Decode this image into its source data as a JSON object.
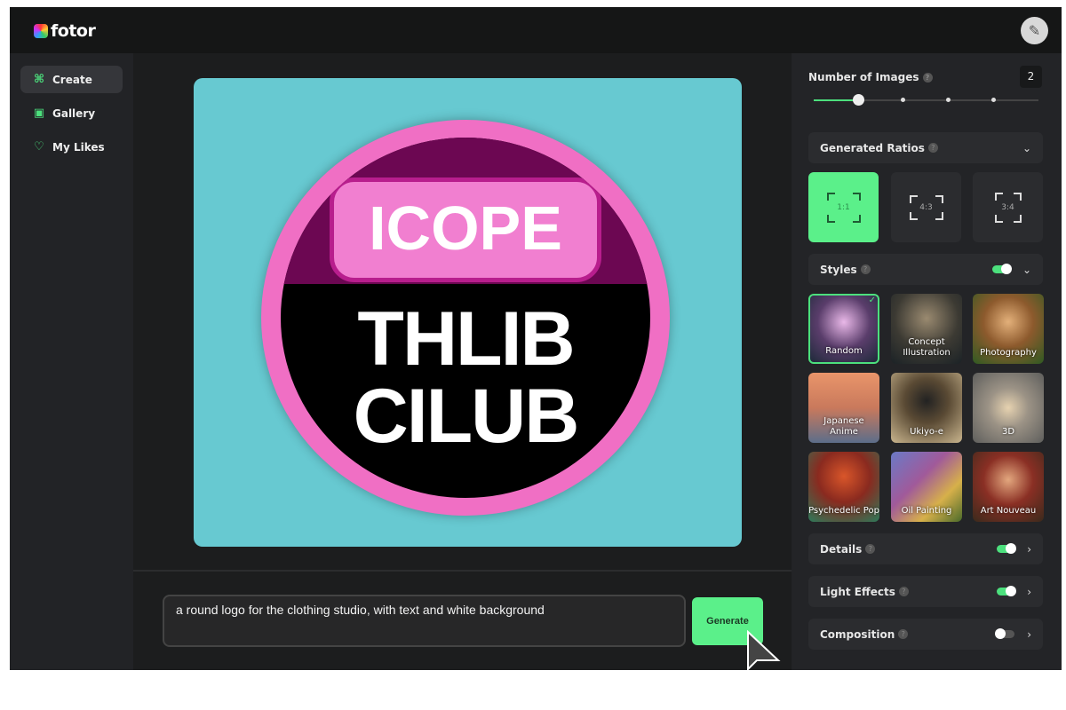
{
  "header": {
    "brand": "fotor",
    "avatar_icon": "user-avatar"
  },
  "sidebar": {
    "items": [
      {
        "label": "Create",
        "icon": "command-icon",
        "active": true
      },
      {
        "label": "Gallery",
        "icon": "gallery-icon"
      },
      {
        "label": "My Likes",
        "icon": "heart-icon"
      }
    ]
  },
  "canvas": {
    "logo_top": "ICOPE",
    "logo_line1": "THLIB",
    "logo_line2": "CILUB"
  },
  "prompt": {
    "value": "a round logo for the clothing studio, with text and white  background",
    "generate_label": "Generate"
  },
  "panel": {
    "number_of_images": {
      "label": "Number of Images",
      "value": "2",
      "min": 1,
      "max": 5
    },
    "ratios": {
      "label": "Generated Ratios",
      "options": [
        "1:1",
        "4:3",
        "3:4"
      ],
      "selected": "1:1"
    },
    "styles": {
      "label": "Styles",
      "enabled": true,
      "items": [
        "Random",
        "Concept Illustration",
        "Photography",
        "Japanese Anime",
        "Ukiyo-e",
        "3D",
        "Psychedelic Pop",
        "Oil Painting",
        "Art Nouveau"
      ],
      "selected": "Random"
    },
    "details": {
      "label": "Details",
      "enabled": true
    },
    "light_effects": {
      "label": "Light Effects",
      "enabled": true
    },
    "composition": {
      "label": "Composition",
      "enabled": false
    }
  },
  "colors": {
    "accent": "#5bf08a",
    "background": "#1c1d1e",
    "canvas": "#67c9d1",
    "logo_ring": "#f06fc4"
  }
}
